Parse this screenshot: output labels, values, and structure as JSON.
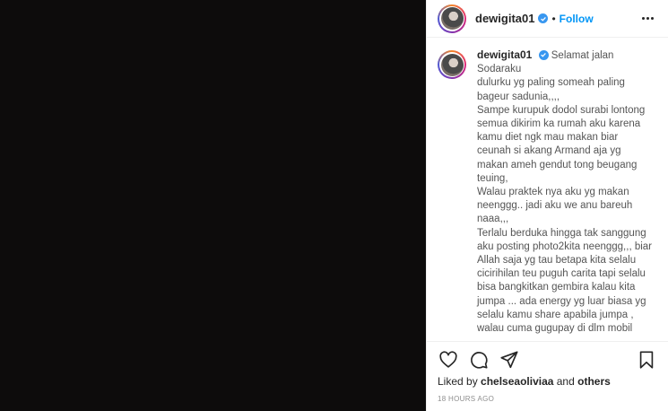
{
  "header": {
    "username": "dewigita01",
    "separator": "•",
    "follow_label": "Follow"
  },
  "caption": {
    "username": "dewigita01",
    "lines": [
      "Selamat jalan Sodaraku",
      "dulurku yg paling someah paling",
      "bageur sadunia,,,,",
      "Sampe kurupuk dodol surabi lontong",
      "semua dikirim ka rumah aku karena",
      "kamu diet ngk mau makan biar",
      "ceunah si akang Armand aja yg",
      "makan ameh gendut tong beugang",
      "teuing,",
      "Walau praktek nya aku yg makan",
      "neenggg.. jadi aku we anu bareuh",
      "naaa,,,",
      "Terlalu berduka hingga tak sanggung",
      "aku posting photo2kita neenggg,,, biar",
      "Allah saja yg tau betapa kita selalu",
      "cicirihilan teu puguh carita tapi selalu",
      "bisa bangkitkan gembira kalau kita",
      "jumpa ... ada energy yg luar biasa yg",
      "selalu kamu share apabila jumpa ,",
      "walau cuma gugupay di dlm mobil"
    ]
  },
  "actions": {
    "like_icon": "heart-icon",
    "comment_icon": "comment-icon",
    "share_icon": "paper-plane-icon",
    "save_icon": "bookmark-icon"
  },
  "likes": {
    "prefix": "Liked by ",
    "user": "chelseaoliviaa",
    "middle": " and ",
    "others": "others"
  },
  "timestamp": "18 HOURS AGO",
  "colors": {
    "media_background": "#0d0c0c",
    "follow": "#0095f6",
    "verified": "#3897f0"
  }
}
